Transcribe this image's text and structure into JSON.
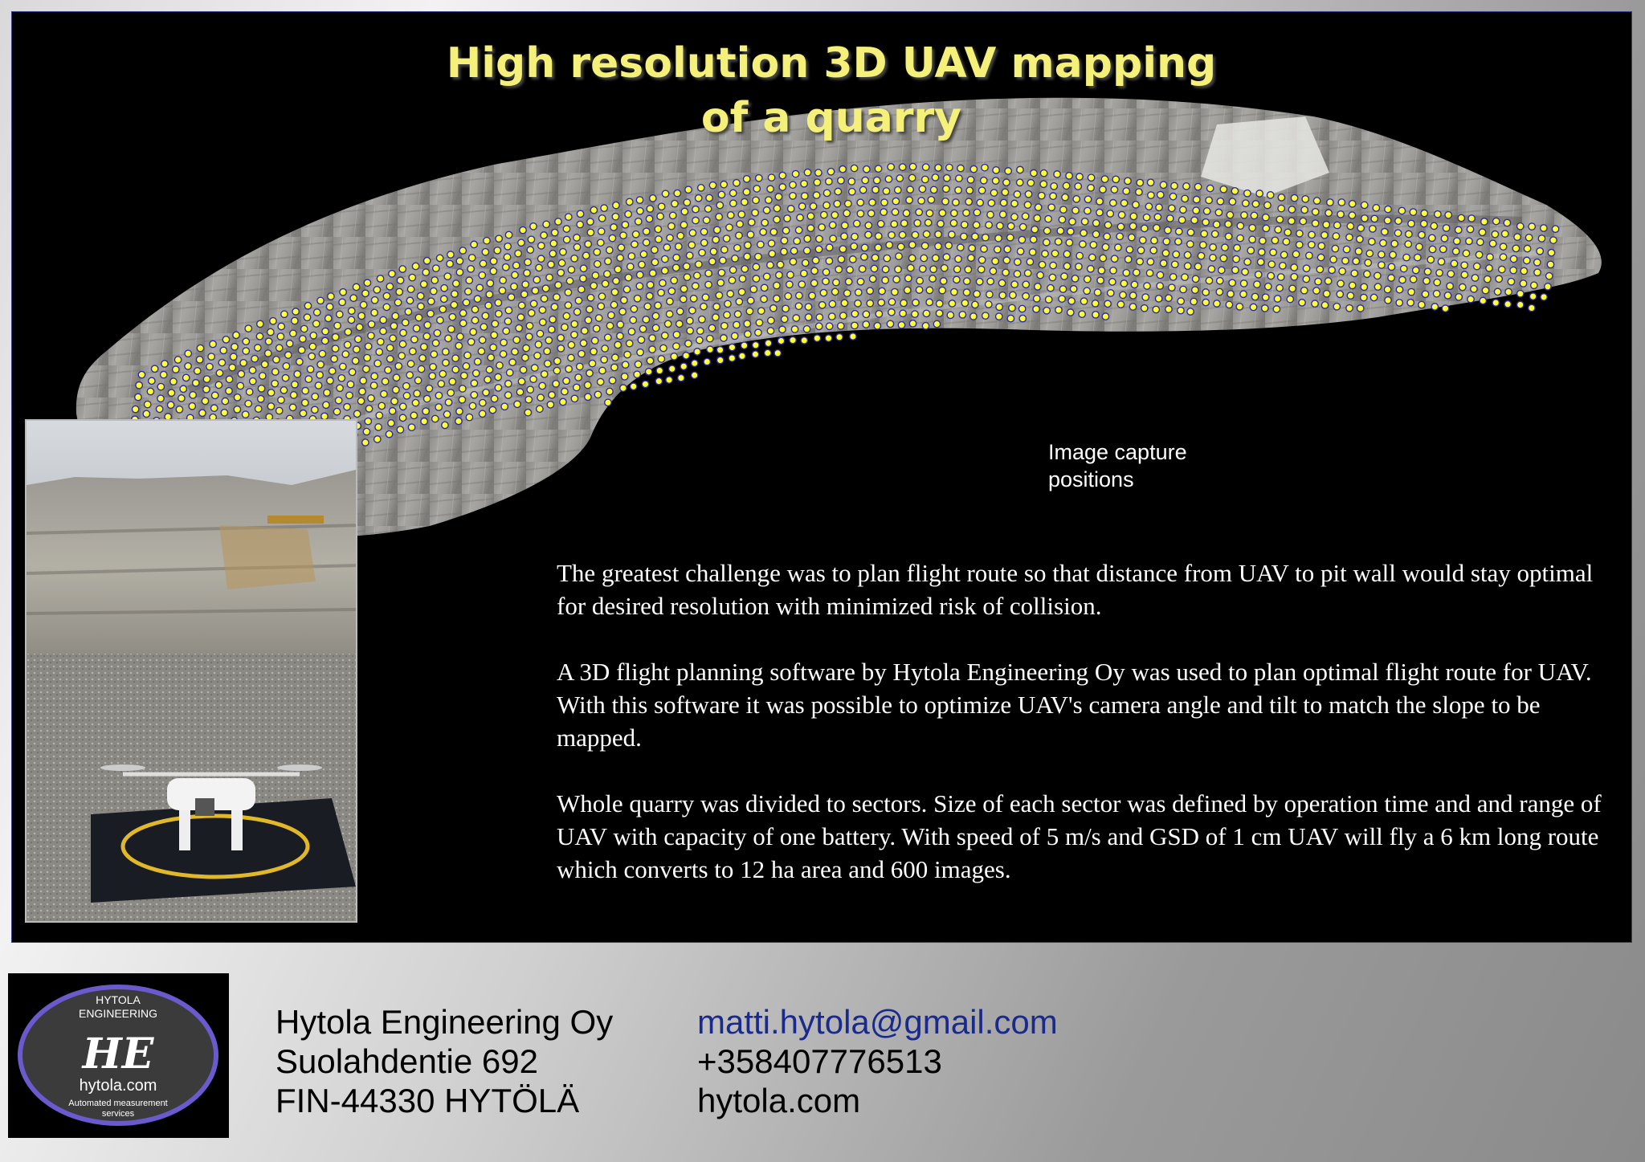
{
  "title": {
    "line1": "High resolution 3D UAV mapping",
    "line2": "of a quarry"
  },
  "caption": {
    "line1": "Image capture",
    "line2": "positions"
  },
  "body": {
    "paragraphs": [
      "The greatest challenge was to plan flight route so that distance from UAV to pit wall would stay optimal for desired resolution with minimized risk of collision.",
      "A 3D flight planning software by Hytola Engineering Oy was used to plan optimal flight route for UAV. With this software it was possible to optimize UAV's camera angle and tilt to match the slope to be mapped.",
      "Whole quarry was divided to sectors. Size of each sector was defined by operation time and and range of UAV with capacity of one battery. With speed of 5 m/s and GSD of 1 cm UAV will fly a 6 km long route which converts to 12 ha area and 600 images."
    ]
  },
  "logo": {
    "top1": "HYTOLA",
    "top2": "ENGINEERING",
    "monogram": "HE",
    "site": "hytola.com",
    "tag1": "Automated measurement",
    "tag2": "services"
  },
  "address": {
    "company": "Hytola Engineering Oy",
    "street": "Suolahdentie 692",
    "city": "FIN-44330 HYTÖLÄ"
  },
  "contact": {
    "email": "matti.hytola@gmail.com",
    "phone": "+358407776513",
    "web": "hytola.com"
  },
  "colors": {
    "title": "#f5f07a",
    "marker": "#ffff33",
    "marker_edge": "#2a2aa8",
    "email": "#1a2a8c",
    "logo_ring": "#6a5acd"
  }
}
